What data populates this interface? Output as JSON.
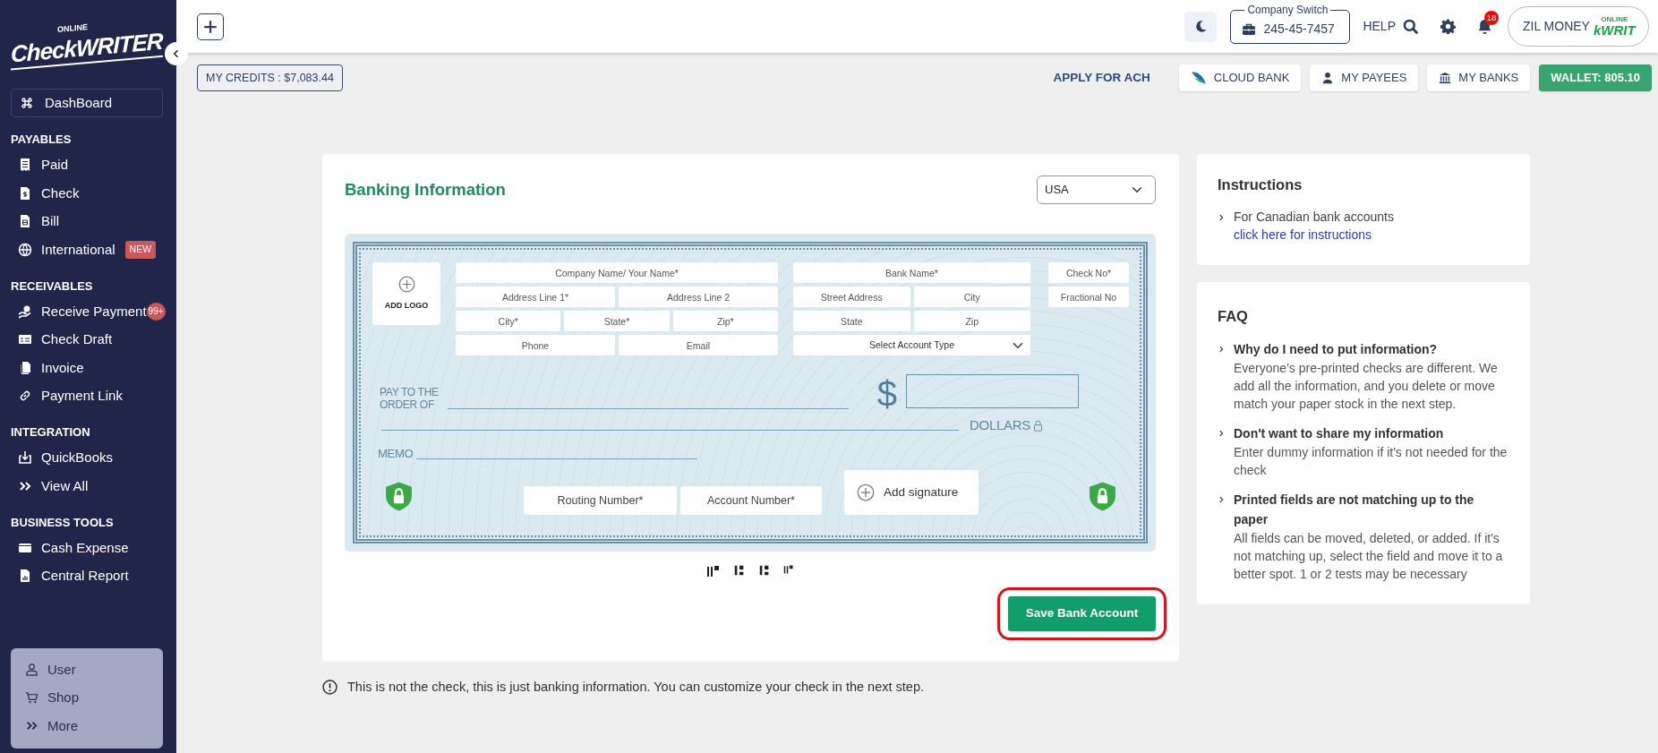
{
  "sidebar": {
    "logo": {
      "tagline": "ONLINE",
      "wordmark": "CheckWRITER"
    },
    "dashboard": "DashBoard",
    "sections": [
      {
        "title": "PAYABLES",
        "items": [
          {
            "label": "Paid"
          },
          {
            "label": "Check"
          },
          {
            "label": "Bill"
          },
          {
            "label": "International",
            "badge": {
              "text": "NEW",
              "kind": "tag"
            }
          }
        ]
      },
      {
        "title": "RECEIVABLES",
        "items": [
          {
            "label": "Receive Payment",
            "badge": {
              "text": "99+",
              "kind": "count"
            }
          },
          {
            "label": "Check Draft"
          },
          {
            "label": "Invoice"
          },
          {
            "label": "Payment Link"
          }
        ]
      },
      {
        "title": "INTEGRATION",
        "items": [
          {
            "label": "QuickBooks"
          },
          {
            "label": "View All"
          }
        ]
      },
      {
        "title": "BUSINESS TOOLS",
        "items": [
          {
            "label": "Cash Expense"
          },
          {
            "label": "Central Report"
          }
        ]
      }
    ],
    "bottom_menu": [
      {
        "label": "User"
      },
      {
        "label": "Shop"
      },
      {
        "label": "More"
      }
    ]
  },
  "topbar": {
    "company_switch": {
      "label": "Company Switch",
      "value": "245-45-7457"
    },
    "help": "HELP",
    "notifications": "18",
    "profile": {
      "name": "ZIL MONEY",
      "logo_tagline": "ONLINE",
      "logo_text": "kWRIT"
    }
  },
  "actions": {
    "credits": "MY CREDITS : $7,083.44",
    "link": "APPLY FOR ACH",
    "buttons": [
      {
        "label": "CLOUD BANK",
        "kind": "plain"
      },
      {
        "label": "MY PAYEES",
        "kind": "plain"
      },
      {
        "label": "MY BANKS",
        "kind": "plain"
      },
      {
        "label": "WALLET: 805.10",
        "kind": "wallet"
      }
    ]
  },
  "banking": {
    "title": "Banking Information",
    "country": "USA",
    "check": {
      "add_logo": "ADD LOGO",
      "payer_rows": [
        [
          {
            "placeholder": "Company Name/ Your Name*"
          }
        ],
        [
          {
            "placeholder": "Address Line 1*"
          },
          {
            "placeholder": "Address Line 2"
          }
        ],
        [
          {
            "placeholder": "City*"
          },
          {
            "placeholder": "State*"
          },
          {
            "placeholder": "Zip*"
          }
        ],
        [
          {
            "placeholder": "Phone"
          },
          {
            "placeholder": "Email"
          }
        ]
      ],
      "bank_rows": [
        [
          {
            "placeholder": "Bank Name*"
          }
        ],
        [
          {
            "placeholder": "Street Address"
          },
          {
            "placeholder": "City"
          }
        ],
        [
          {
            "placeholder": "State"
          },
          {
            "placeholder": "Zip"
          }
        ]
      ],
      "account_type": "Select Account Type",
      "number_fields": [
        {
          "placeholder": "Check No*"
        },
        {
          "placeholder": "Fractional No"
        }
      ],
      "pay_to": "PAY TO THE\nORDER OF",
      "currency": "$",
      "dollars": "DOLLARS",
      "memo": "MEMO",
      "routing": {
        "placeholder": "Routing Number*"
      },
      "account": {
        "placeholder": "Account Number*"
      },
      "signature": "Add signature"
    },
    "save": "Save Bank Account",
    "note": "This is not the check, this is just banking information. You can customize your check in the next step."
  },
  "instructions": {
    "title": "Instructions",
    "items": [
      {
        "text": "For Canadian bank accounts",
        "link": "click here for instructions"
      }
    ]
  },
  "faq": {
    "title": "FAQ",
    "items": [
      {
        "question": "Why do I need to put information?",
        "answer": "Everyone's pre-printed checks are different. We add all the information, and you delete or move match your paper stock in the next step."
      },
      {
        "question": "Don't want to share my information",
        "answer": "Enter dummy information if it's not needed for the check"
      },
      {
        "question": "Printed fields are not matching up to the paper",
        "answer": "All fields can be moved, deleted, or added. If it's not matching up, select the field and move it to a better spot. 1 or 2 tests may be necessary"
      }
    ]
  }
}
